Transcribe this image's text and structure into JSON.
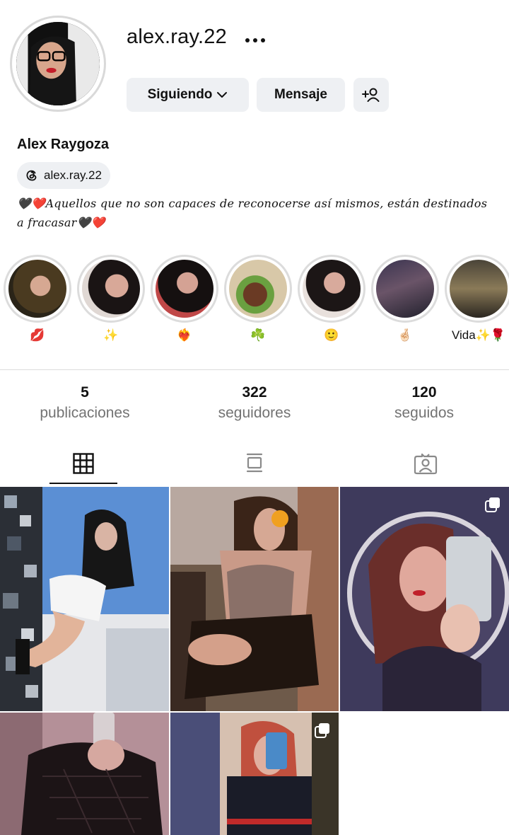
{
  "profile": {
    "username": "alex.ray.22",
    "display_name": "Alex Raygoza",
    "threads_handle": "alex.ray.22",
    "bio": "🖤❤️Aquellos que no son capaces de reconocerse así mismos, están destinados a fracasar🖤❤️"
  },
  "actions": {
    "following_label": "Siguiendo",
    "message_label": "Mensaje"
  },
  "highlights": [
    {
      "label": "💋",
      "icon": "lips-emoji"
    },
    {
      "label": "✨",
      "icon": "sparkles-emoji"
    },
    {
      "label": "❤️‍🔥",
      "icon": "heart-on-fire-emoji"
    },
    {
      "label": "☘️",
      "icon": "shamrock-emoji"
    },
    {
      "label": "🙂",
      "icon": "smile-emoji"
    },
    {
      "label": "🤞🏻",
      "icon": "crossed-fingers-emoji"
    },
    {
      "label": "Vida✨🌹",
      "icon": "text-emoji"
    }
  ],
  "stats": [
    {
      "value": "5",
      "label": "publicaciones"
    },
    {
      "value": "322",
      "label": "seguidores"
    },
    {
      "value": "120",
      "label": "seguidos"
    }
  ],
  "tabs": [
    {
      "name": "tab-posts-grid",
      "icon": "grid-icon",
      "active": true
    },
    {
      "name": "tab-reels-feed",
      "icon": "feed-icon",
      "active": false
    },
    {
      "name": "tab-tagged",
      "icon": "tagged-person-icon",
      "active": false
    }
  ],
  "posts": [
    {
      "type": "photo",
      "colors": [
        "#5b8fd4",
        "#1b1b1b",
        "#e8e8ea"
      ]
    },
    {
      "type": "photo",
      "colors": [
        "#6e5a4a",
        "#c99a88",
        "#2a1e18"
      ]
    },
    {
      "type": "carousel",
      "colors": [
        "#3e3a5c",
        "#b3626a",
        "#d8d4dc"
      ]
    },
    {
      "type": "photo",
      "colors": [
        "#8c6a72",
        "#1c1416",
        "#b49098"
      ]
    },
    {
      "type": "carousel",
      "colors": [
        "#4a4e78",
        "#c0503e",
        "#d6c0b0"
      ]
    }
  ],
  "colors": {
    "button_bg": "#eef0f3",
    "muted_text": "#737373",
    "divider": "#dbdbdb"
  }
}
